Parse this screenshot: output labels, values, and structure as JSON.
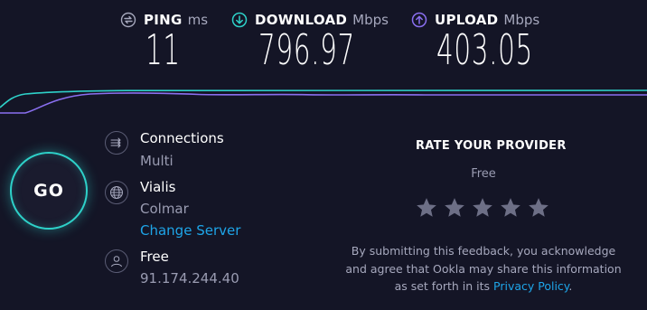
{
  "metrics": {
    "ping": {
      "label": "PING",
      "unit": "ms",
      "value": "11",
      "icon": "ping-icon"
    },
    "download": {
      "label": "DOWNLOAD",
      "unit": "Mbps",
      "value": "796.97",
      "icon": "download-arrow-icon"
    },
    "upload": {
      "label": "UPLOAD",
      "unit": "Mbps",
      "value": "403.05",
      "icon": "upload-arrow-icon"
    }
  },
  "colors": {
    "download": "#2ed1c9",
    "upload": "#8a6ff0",
    "link": "#1ea5e8",
    "background": "#141526"
  },
  "go_button": {
    "label": "GO"
  },
  "connections": {
    "title": "Connections",
    "value": "Multi",
    "icon": "connections-icon"
  },
  "server": {
    "name": "Vialis",
    "location": "Colmar",
    "change_label": "Change Server",
    "icon": "globe-icon"
  },
  "provider": {
    "name": "Free",
    "ip": "91.174.244.40",
    "icon": "user-icon"
  },
  "rate": {
    "title": "RATE YOUR PROVIDER",
    "provider": "Free",
    "stars": 5,
    "disclaimer_text": "By submitting this feedback, you acknowledge and agree that Ookla may share this information as set forth in its ",
    "privacy_label": "Privacy Policy",
    "disclaimer_end": "."
  }
}
